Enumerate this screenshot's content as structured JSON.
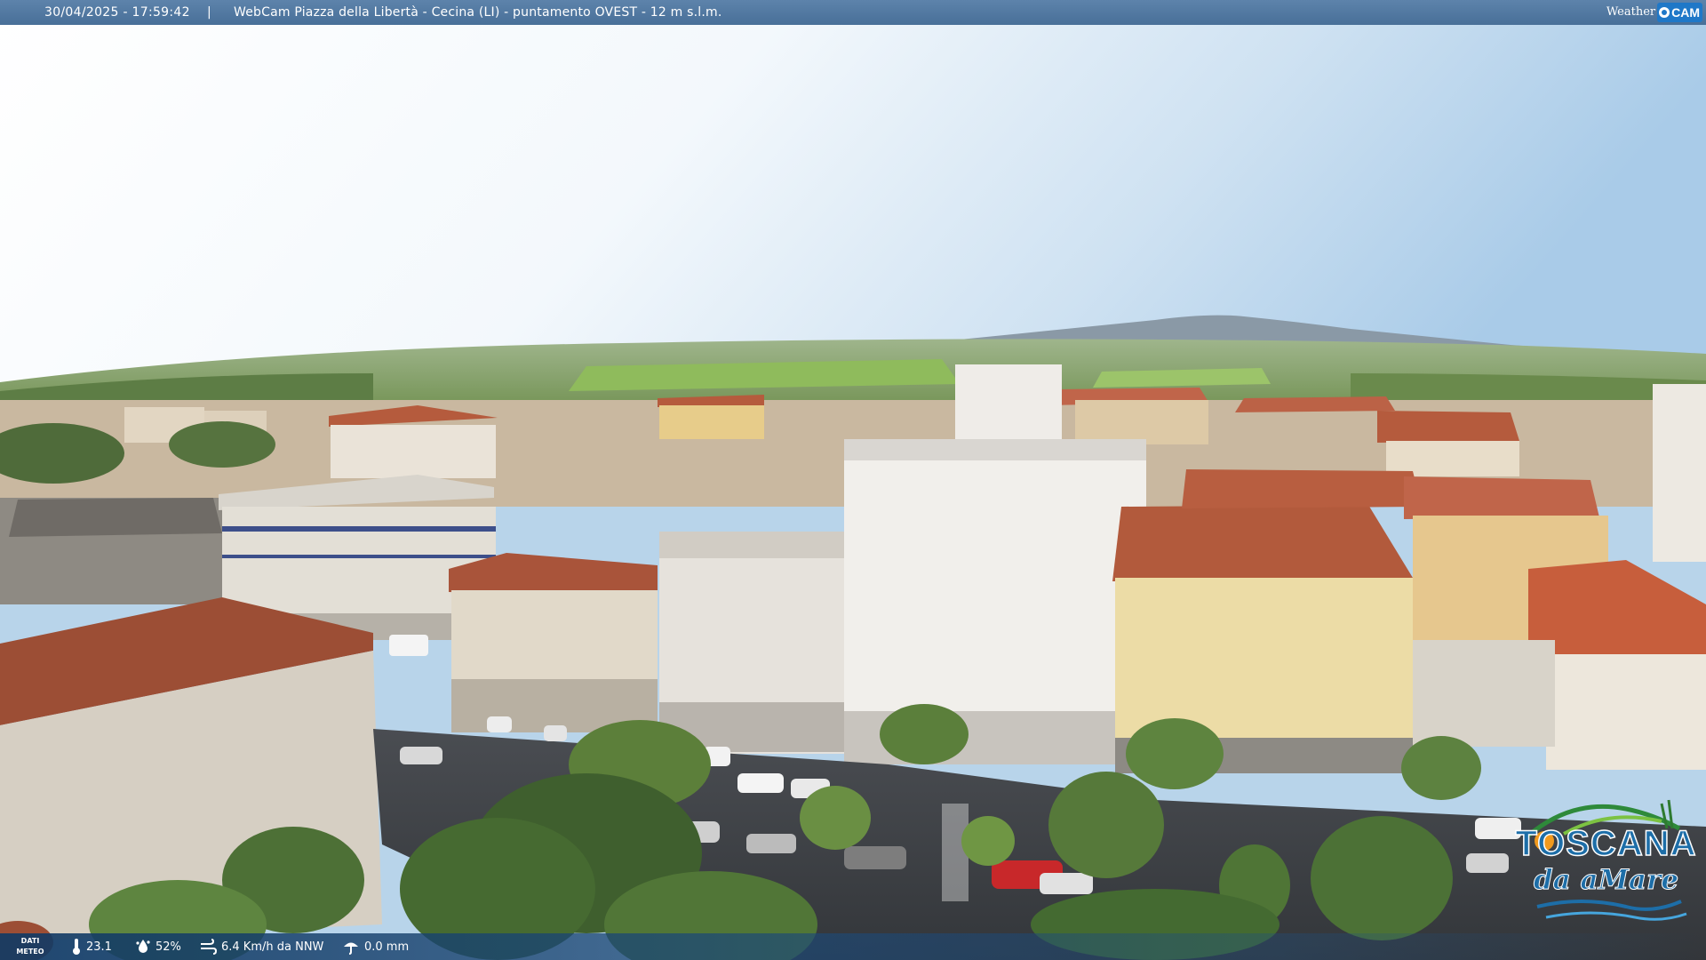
{
  "header": {
    "timestamp": "30/04/2025 - 17:59:42",
    "separator": "|",
    "title": "WebCam Piazza della Libertà - Cecina (LI) - puntamento OVEST - 12 m s.l.m."
  },
  "weathercam_logo": {
    "word": "Weather",
    "cam": "CAM",
    "icon": "camera-eye-icon"
  },
  "weather": {
    "label": "DATI METEO",
    "temperature": "23.1",
    "humidity": "52%",
    "wind": "6.4 Km/h da NNW",
    "rain": "0.0 mm",
    "icons": [
      "thermometer-icon",
      "humidity-icon",
      "wind-icon",
      "rain-gauge-icon"
    ]
  },
  "toscana_logo": {
    "word": "TOSCANA",
    "sub": "da aMare"
  },
  "colors": {
    "header_bar": "#4f76a0",
    "sky_top": "#a9cbe8",
    "roof": "#b55b3d",
    "toscana_blue": "#1d6ea8",
    "toscana_orange": "#f19a1e"
  }
}
